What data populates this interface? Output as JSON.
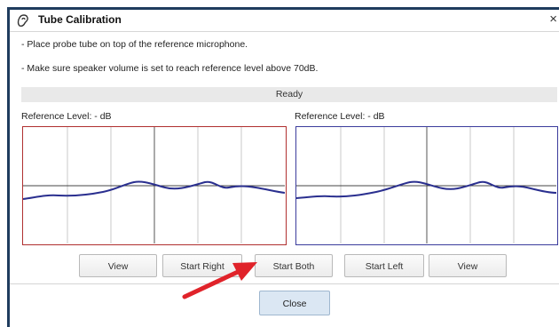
{
  "window": {
    "title": "Tube Calibration",
    "close_glyph": "×"
  },
  "instructions": {
    "line1": "- Place probe tube on top of the reference microphone.",
    "line2": "- Make sure speaker volume is set to reach reference level above 70dB."
  },
  "status": {
    "text": "Ready"
  },
  "left_panel": {
    "reference_label": "Reference Level: - dB",
    "border_color": "#b03030"
  },
  "right_panel": {
    "reference_label": "Reference Level: - dB",
    "border_color": "#3b3c9c"
  },
  "buttons": {
    "view_left": "View",
    "start_right": "Start Right",
    "start_both": "Start Both",
    "start_left": "Start Left",
    "view_right": "View",
    "close": "Close"
  },
  "annotation": {
    "arrow_color": "#e0232a",
    "points_to": "start-both-button"
  },
  "icons": {
    "app": "ear-icon",
    "close": "close-icon"
  }
}
